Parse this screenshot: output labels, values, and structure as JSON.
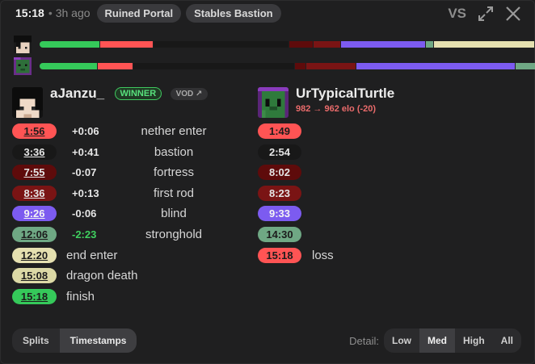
{
  "header": {
    "time": "15:18",
    "separator": "•",
    "ago": "3h ago",
    "tags": [
      "Ruined Portal",
      "Stables Bastion"
    ],
    "vs_label": "VS",
    "icons": [
      "expand-icon",
      "close-icon"
    ]
  },
  "colors": {
    "nether_enter": "#ff5454",
    "bastion": "#181818",
    "fortress": "#5e0b0b",
    "first_rod": "#7a1414",
    "blind": "#7c5bf0",
    "stronghold": "#6fa884",
    "end_enter": "#e5e0b0",
    "dragon_death": "#dcd9a6",
    "finish": "#35c95a",
    "loss": "#ff5454"
  },
  "timeline": {
    "player1": [
      {
        "split": "overworld",
        "color": "#35c95a",
        "fraction": 0.12
      },
      {
        "split": "nether enter",
        "color": "#ff5454",
        "fraction": 0.105
      },
      {
        "split": "bastion",
        "color": "#181818",
        "fraction": 0.27
      },
      {
        "split": "fortress",
        "color": "#5e0b0b",
        "fraction": 0.048
      },
      {
        "split": "first rod",
        "color": "#7a1414",
        "fraction": 0.055
      },
      {
        "split": "blind",
        "color": "#7c5bf0",
        "fraction": 0.168
      },
      {
        "split": "stronghold",
        "color": "#6fa884",
        "fraction": 0.016
      },
      {
        "split": "end enter",
        "color": "#e5e0b0",
        "fraction": 0.2
      },
      {
        "split": "dragon death",
        "color": "#7fb08e",
        "fraction": 0.018
      }
    ],
    "player2": [
      {
        "split": "overworld",
        "color": "#35c95a",
        "fraction": 0.116
      },
      {
        "split": "nether enter",
        "color": "#ff5454",
        "fraction": 0.07
      },
      {
        "split": "bastion",
        "color": "#181818",
        "fraction": 0.32
      },
      {
        "split": "fortress",
        "color": "#5e0b0b",
        "fraction": 0.022
      },
      {
        "split": "first rod",
        "color": "#7a1414",
        "fraction": 0.1
      },
      {
        "split": "blind",
        "color": "#7c5bf0",
        "fraction": 0.315
      },
      {
        "split": "stronghold",
        "color": "#6fa884",
        "fraction": 0.057
      }
    ]
  },
  "player1": {
    "name": "aJanzu_",
    "winner_label": "WINNER",
    "vod_label": "VOD ↗",
    "splits": [
      {
        "time": "1:56",
        "delta": "+0:06",
        "label": "nether enter",
        "color": "#ff5454",
        "text_color": "#1c1c1c",
        "delta_color": "#e6e6e6"
      },
      {
        "time": "3:36",
        "delta": "+0:41",
        "label": "bastion",
        "color": "#181818",
        "text_color": "#e6e6e6",
        "delta_color": "#e6e6e6"
      },
      {
        "time": "7:55",
        "delta": "-0:07",
        "label": "fortress",
        "color": "#5e0b0b",
        "text_color": "#e6e6e6",
        "delta_color": "#e6e6e6"
      },
      {
        "time": "8:36",
        "delta": "+0:13",
        "label": "first rod",
        "color": "#7a1414",
        "text_color": "#e6e6e6",
        "delta_color": "#e6e6e6"
      },
      {
        "time": "9:26",
        "delta": "-0:06",
        "label": "blind",
        "color": "#7c5bf0",
        "text_color": "#f4f4f4",
        "delta_color": "#e6e6e6"
      },
      {
        "time": "12:06",
        "delta": "-2:23",
        "label": "stronghold",
        "color": "#6fa884",
        "text_color": "#1c1c1c",
        "delta_color": "#3fd05f"
      },
      {
        "time": "12:20",
        "delta": "",
        "label": "end enter",
        "color": "#e5e0b0",
        "text_color": "#1c1c1c",
        "delta_color": "#e6e6e6"
      },
      {
        "time": "15:08",
        "delta": "",
        "label": "dragon death",
        "color": "#dcd9a6",
        "text_color": "#1c1c1c",
        "delta_color": "#e6e6e6"
      },
      {
        "time": "15:18",
        "delta": "",
        "label": "finish",
        "color": "#35c95a",
        "text_color": "#1c1c1c",
        "delta_color": "#e6e6e6"
      }
    ]
  },
  "player2": {
    "name": "UrTypicalTurtle",
    "elo_change": "982 → 962 elo (-20)",
    "splits": [
      {
        "time": "1:49",
        "color": "#ff5454",
        "text_color": "#1c1c1c"
      },
      {
        "time": "2:54",
        "color": "#181818",
        "text_color": "#e6e6e6"
      },
      {
        "time": "8:02",
        "color": "#5e0b0b",
        "text_color": "#e6e6e6"
      },
      {
        "time": "8:23",
        "color": "#7a1414",
        "text_color": "#e6e6e6"
      },
      {
        "time": "9:33",
        "color": "#7c5bf0",
        "text_color": "#f4f4f4"
      },
      {
        "time": "14:30",
        "color": "#6fa884",
        "text_color": "#1c1c1c"
      },
      {
        "time": "15:18",
        "color": "#ff5454",
        "text_color": "#1c1c1c",
        "label": "loss"
      }
    ]
  },
  "view_toggle": {
    "options": [
      "Splits",
      "Timestamps"
    ],
    "selected": "Timestamps"
  },
  "detail": {
    "label": "Detail:",
    "options": [
      "Low",
      "Med",
      "High",
      "All"
    ],
    "selected": "Med"
  }
}
